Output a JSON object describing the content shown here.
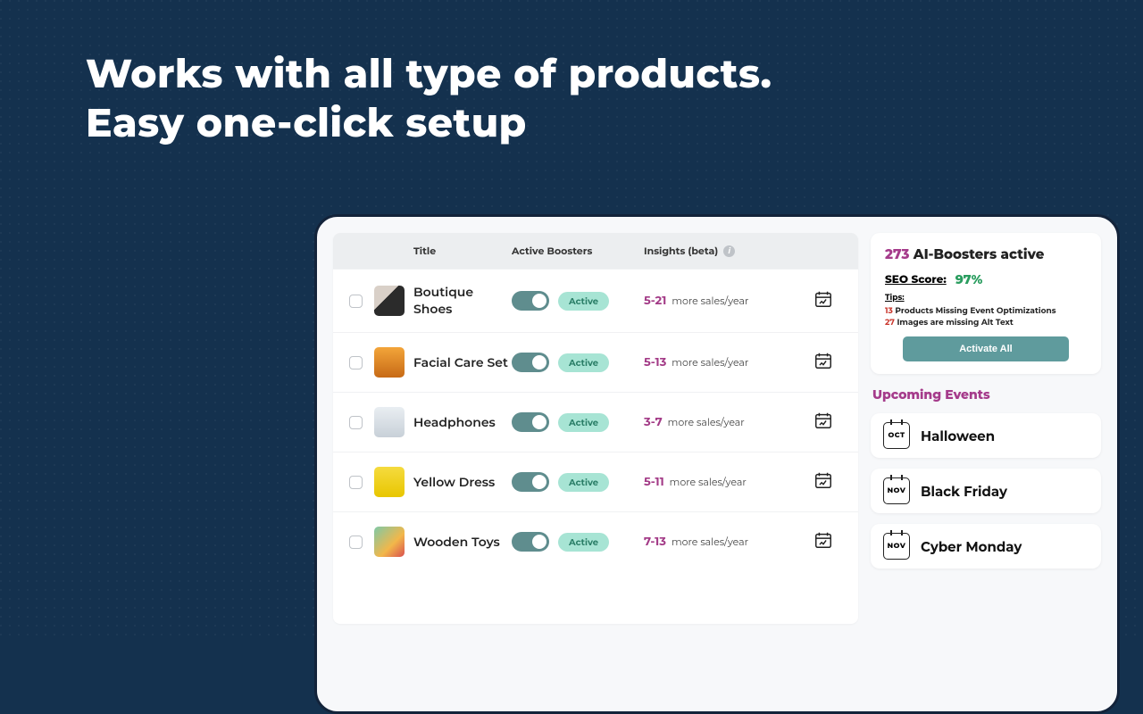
{
  "headline": {
    "line1": "Works with all type of products.",
    "line2": "Easy one-click setup"
  },
  "columns": {
    "title": "Title",
    "boosters": "Active Boosters",
    "insights": "Insights (beta)"
  },
  "products": [
    {
      "title": "Boutique Shoes",
      "active_label": "Active",
      "insight_range": "5-21",
      "insight_suffix": "more sales/year"
    },
    {
      "title": "Facial Care Set",
      "active_label": "Active",
      "insight_range": "5-13",
      "insight_suffix": "more sales/year"
    },
    {
      "title": "Headphones",
      "active_label": "Active",
      "insight_range": "3-7",
      "insight_suffix": "more sales/year"
    },
    {
      "title": "Yellow Dress",
      "active_label": "Active",
      "insight_range": "5-11",
      "insight_suffix": "more sales/year"
    },
    {
      "title": "Wooden Toys",
      "active_label": "Active",
      "insight_range": "7-13",
      "insight_suffix": "more sales/year"
    }
  ],
  "sidebar": {
    "boosters_count": "273",
    "boosters_label": "AI-Boosters active",
    "seo_label": "SEO Score:",
    "seo_value": "97%",
    "tips_label": "Tips:",
    "tips": [
      {
        "num": "13",
        "text": "Products Missing Event Optimizations"
      },
      {
        "num": "27",
        "text": "Images are missing Alt Text"
      }
    ],
    "activate_all": "Activate All",
    "events_title": "Upcoming Events",
    "events": [
      {
        "month": "OCT",
        "name": "Halloween"
      },
      {
        "month": "NOV",
        "name": "Black Friday"
      },
      {
        "month": "NOV",
        "name": "Cyber Monday"
      }
    ]
  }
}
